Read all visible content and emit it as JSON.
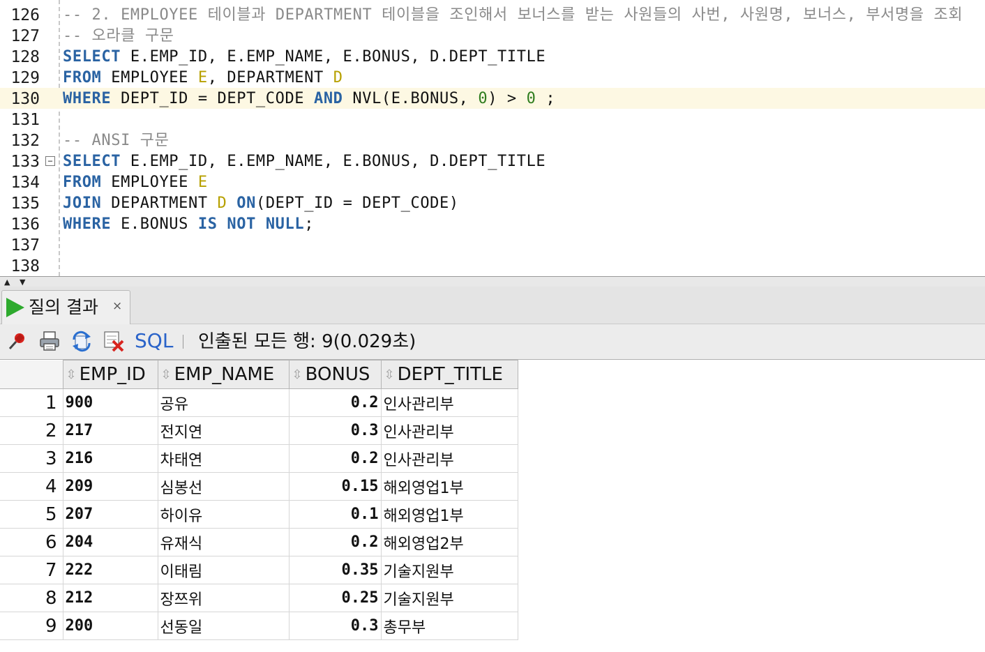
{
  "editor": {
    "lines": [
      {
        "num": "126",
        "segs": [
          {
            "t": "-- 2. EMPLOYEE 테이블과 DEPARTMENT 테이블을 조인해서 보너스를 받는 사원들의 사번, 사원명, 보너스, 부서명을 조회",
            "c": "cm"
          }
        ]
      },
      {
        "num": "127",
        "segs": [
          {
            "t": "-- 오라클 구문",
            "c": "cm"
          }
        ]
      },
      {
        "num": "128",
        "segs": [
          {
            "t": "SELECT",
            "c": "kw"
          },
          {
            "t": " E.EMP_ID, E.EMP_NAME, E.BONUS, D.DEPT_TITLE",
            "c": ""
          }
        ]
      },
      {
        "num": "129",
        "segs": [
          {
            "t": "FROM",
            "c": "kw"
          },
          {
            "t": " EMPLOYEE ",
            "c": ""
          },
          {
            "t": "E",
            "c": "al"
          },
          {
            "t": ", DEPARTMENT ",
            "c": ""
          },
          {
            "t": "D",
            "c": "al"
          }
        ]
      },
      {
        "num": "130",
        "current": true,
        "segs": [
          {
            "t": "WHERE",
            "c": "kw"
          },
          {
            "t": " DEPT_ID = DEPT_CODE ",
            "c": ""
          },
          {
            "t": "AND",
            "c": "kw"
          },
          {
            "t": " NVL(E.BONUS, ",
            "c": ""
          },
          {
            "t": "0",
            "c": "nm"
          },
          {
            "t": ") > ",
            "c": ""
          },
          {
            "t": "0",
            "c": "nm"
          },
          {
            "t": " ;",
            "c": ""
          }
        ]
      },
      {
        "num": "131",
        "segs": []
      },
      {
        "num": "132",
        "segs": [
          {
            "t": "-- ANSI 구문",
            "c": "cm"
          }
        ]
      },
      {
        "num": "133",
        "segs": [
          {
            "t": "SELECT",
            "c": "kw"
          },
          {
            "t": " E.EMP_ID, E.EMP_NAME, E.BONUS, D.DEPT_TITLE",
            "c": ""
          }
        ]
      },
      {
        "num": "134",
        "segs": [
          {
            "t": "FROM",
            "c": "kw"
          },
          {
            "t": " EMPLOYEE ",
            "c": ""
          },
          {
            "t": "E",
            "c": "al"
          }
        ]
      },
      {
        "num": "135",
        "segs": [
          {
            "t": "JOIN",
            "c": "kw"
          },
          {
            "t": " DEPARTMENT ",
            "c": ""
          },
          {
            "t": "D",
            "c": "al"
          },
          {
            "t": " ",
            "c": ""
          },
          {
            "t": "ON",
            "c": "kw"
          },
          {
            "t": "(DEPT_ID = DEPT_CODE)",
            "c": ""
          }
        ]
      },
      {
        "num": "136",
        "segs": [
          {
            "t": "WHERE",
            "c": "kw"
          },
          {
            "t": " E.BONUS ",
            "c": ""
          },
          {
            "t": "IS",
            "c": "kw"
          },
          {
            "t": " ",
            "c": ""
          },
          {
            "t": "NOT",
            "c": "kw"
          },
          {
            "t": " ",
            "c": ""
          },
          {
            "t": "NULL",
            "c": "kw"
          },
          {
            "t": ";",
            "c": ""
          }
        ]
      },
      {
        "num": "137",
        "segs": []
      },
      {
        "num": "138",
        "segs": []
      }
    ],
    "fold_symbol": "−"
  },
  "results": {
    "tab_label": "질의 결과",
    "tab_close": "×",
    "toolbar_sql": "SQL",
    "status": "인출된 모든 행: 9(0.029초)",
    "columns": [
      "EMP_ID",
      "EMP_NAME",
      "BONUS",
      "DEPT_TITLE"
    ],
    "rows": [
      {
        "n": "1",
        "emp_id": "900",
        "emp_name": "공유",
        "bonus": "0.2",
        "dept": "인사관리부"
      },
      {
        "n": "2",
        "emp_id": "217",
        "emp_name": "전지연",
        "bonus": "0.3",
        "dept": "인사관리부"
      },
      {
        "n": "3",
        "emp_id": "216",
        "emp_name": "차태연",
        "bonus": "0.2",
        "dept": "인사관리부"
      },
      {
        "n": "4",
        "emp_id": "209",
        "emp_name": "심봉선",
        "bonus": "0.15",
        "dept": "해외영업1부"
      },
      {
        "n": "5",
        "emp_id": "207",
        "emp_name": "하이유",
        "bonus": "0.1",
        "dept": "해외영업1부"
      },
      {
        "n": "6",
        "emp_id": "204",
        "emp_name": "유재식",
        "bonus": "0.2",
        "dept": "해외영업2부"
      },
      {
        "n": "7",
        "emp_id": "222",
        "emp_name": "이태림",
        "bonus": "0.35",
        "dept": "기술지원부"
      },
      {
        "n": "8",
        "emp_id": "212",
        "emp_name": "장쯔위",
        "bonus": "0.25",
        "dept": "기술지원부"
      },
      {
        "n": "9",
        "emp_id": "200",
        "emp_name": "선동일",
        "bonus": "0.3",
        "dept": "총무부"
      }
    ]
  },
  "colors": {
    "keyword": "#2a63a3",
    "comment": "#8a8a8a",
    "alias": "#b7a000",
    "number": "#2f7d1e",
    "current_line": "#fdf8e3",
    "run_icon": "#2eaa2e"
  },
  "icons": [
    "freeze-view-pin-icon",
    "print-icon",
    "refresh-icon",
    "delete-rows-icon"
  ]
}
